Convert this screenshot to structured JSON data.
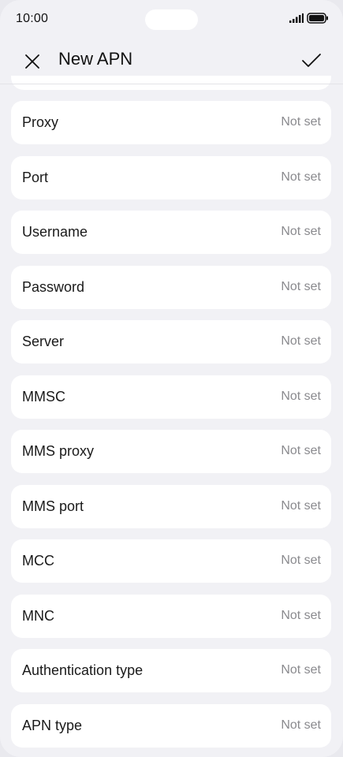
{
  "status_bar": {
    "time": "10:00",
    "signal_icon": "signal-icon",
    "battery_icon": "battery-icon"
  },
  "header": {
    "title": "New APN",
    "close_icon": "close-icon",
    "confirm_icon": "checkmark-icon"
  },
  "fields": [
    {
      "label": "Proxy",
      "value": "Not set"
    },
    {
      "label": "Port",
      "value": "Not set"
    },
    {
      "label": "Username",
      "value": "Not set"
    },
    {
      "label": "Password",
      "value": "Not set"
    },
    {
      "label": "Server",
      "value": "Not set"
    },
    {
      "label": "MMSC",
      "value": "Not set"
    },
    {
      "label": "MMS proxy",
      "value": "Not set"
    },
    {
      "label": "MMS port",
      "value": "Not set"
    },
    {
      "label": "MCC",
      "value": "Not set"
    },
    {
      "label": "MNC",
      "value": "Not set"
    },
    {
      "label": "Authentication type",
      "value": "Not set"
    },
    {
      "label": "APN type",
      "value": "Not set"
    }
  ],
  "colors": {
    "background": "#f1f1f5",
    "card": "#ffffff",
    "text_primary": "#1a1a1a",
    "text_secondary": "#8a8a8e"
  }
}
